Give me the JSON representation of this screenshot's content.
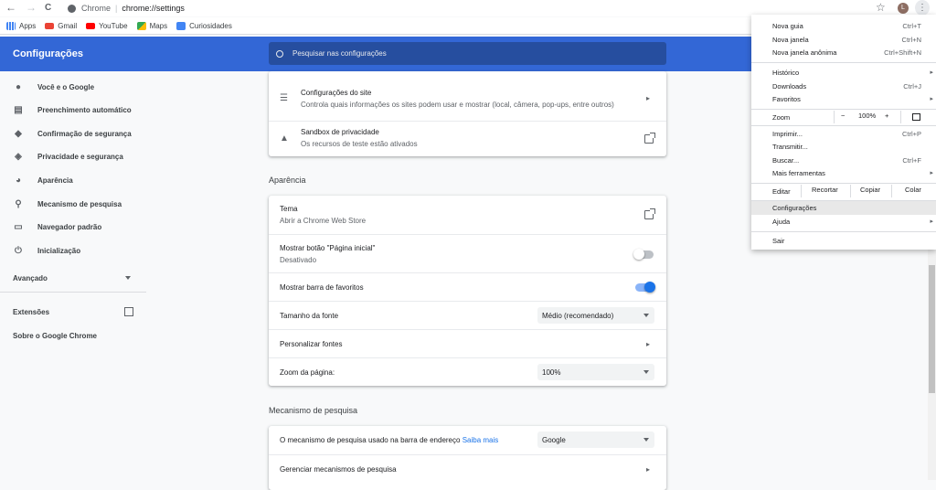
{
  "toolbar": {
    "back": "←",
    "forward": "→",
    "reload": "C",
    "site_name": "Chrome",
    "url": "chrome://settings",
    "avatar": "L"
  },
  "bookmarks": [
    {
      "label": "Apps",
      "color": "#5f6368"
    },
    {
      "label": "Gmail",
      "color": "#ea4335"
    },
    {
      "label": "YouTube",
      "color": "#ff0000"
    },
    {
      "label": "Maps",
      "color": "#34a853"
    },
    {
      "label": "Curiosidades",
      "color": "#4285f4"
    }
  ],
  "header": {
    "title": "Configurações",
    "search_placeholder": "Pesquisar nas configurações",
    "accent": "#3367d6"
  },
  "sidebar": {
    "items": [
      {
        "label": "Você e o Google",
        "icon": "person-icon"
      },
      {
        "label": "Preenchimento automático",
        "icon": "clipboard-icon"
      },
      {
        "label": "Confirmação de segurança",
        "icon": "shield-check-icon"
      },
      {
        "label": "Privacidade e segurança",
        "icon": "shield-icon"
      },
      {
        "label": "Aparência",
        "icon": "palette-icon"
      },
      {
        "label": "Mecanismo de pesquisa",
        "icon": "search-icon"
      },
      {
        "label": "Navegador padrão",
        "icon": "browser-icon"
      },
      {
        "label": "Inicialização",
        "icon": "power-icon"
      }
    ],
    "advanced": "Avançado",
    "extensions": "Extensões",
    "about": "Sobre o Google Chrome"
  },
  "privacy_card": {
    "site_settings": {
      "title": "Configurações do site",
      "subtitle": "Controla quais informações os sites podem usar e mostrar (local, câmera, pop-ups, entre outros)"
    },
    "sandbox": {
      "title": "Sandbox de privacidade",
      "subtitle": "Os recursos de teste estão ativados"
    }
  },
  "appearance": {
    "section_title": "Aparência",
    "theme": {
      "title": "Tema",
      "subtitle": "Abrir a Chrome Web Store"
    },
    "home_button": {
      "title": "Mostrar botão \"Página inicial\"",
      "subtitle": "Desativado",
      "enabled": false
    },
    "bookmarks_bar": {
      "title": "Mostrar barra de favoritos",
      "enabled": true
    },
    "font_size": {
      "title": "Tamanho da fonte",
      "value": "Médio (recomendado)"
    },
    "custom_fonts": {
      "title": "Personalizar fontes"
    },
    "page_zoom": {
      "title": "Zoom da página:",
      "value": "100%"
    }
  },
  "search_engine": {
    "section_title": "Mecanismo de pesquisa",
    "engine": {
      "title": "O mecanismo de pesquisa usado na barra de endereço",
      "link": "Saiba mais",
      "value": "Google"
    },
    "manage": {
      "title": "Gerenciar mecanismos de pesquisa"
    }
  },
  "menu": {
    "new_tab": {
      "label": "Nova guia",
      "shortcut": "Ctrl+T"
    },
    "new_window": {
      "label": "Nova janela",
      "shortcut": "Ctrl+N"
    },
    "incognito": {
      "label": "Nova janela anônima",
      "shortcut": "Ctrl+Shift+N"
    },
    "history": {
      "label": "Histórico"
    },
    "downloads": {
      "label": "Downloads",
      "shortcut": "Ctrl+J"
    },
    "favorites": {
      "label": "Favoritos"
    },
    "zoom": {
      "label": "Zoom",
      "minus": "−",
      "value": "100%",
      "plus": "+"
    },
    "print": {
      "label": "Imprimir...",
      "shortcut": "Ctrl+P"
    },
    "cast": {
      "label": "Transmitir..."
    },
    "find": {
      "label": "Buscar...",
      "shortcut": "Ctrl+F"
    },
    "more_tools": {
      "label": "Mais ferramentas"
    },
    "edit": {
      "label": "Editar",
      "cut": "Recortar",
      "copy": "Copiar",
      "paste": "Colar"
    },
    "settings": {
      "label": "Configurações"
    },
    "help": {
      "label": "Ajuda"
    },
    "exit": {
      "label": "Sair"
    }
  }
}
